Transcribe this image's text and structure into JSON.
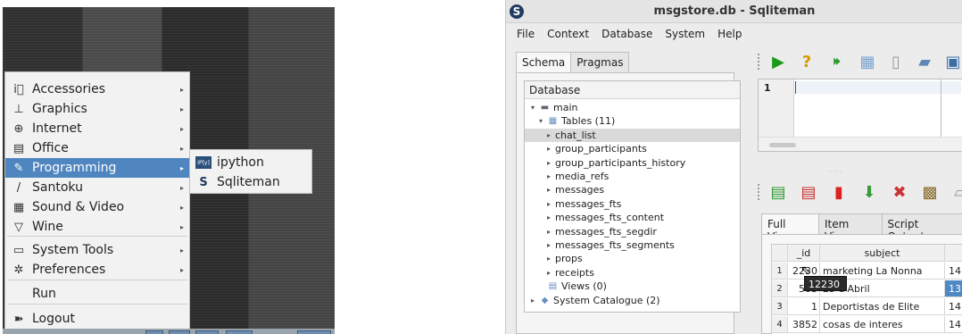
{
  "start_menu": {
    "items": [
      {
        "label": "Accessories",
        "icon": "accessories-icon",
        "glyph": "i⃓",
        "submenu": true
      },
      {
        "label": "Graphics",
        "icon": "graphics-icon",
        "glyph": "⊥",
        "submenu": true
      },
      {
        "label": "Internet",
        "icon": "internet-icon",
        "glyph": "⊕",
        "submenu": true
      },
      {
        "label": "Office",
        "icon": "office-icon",
        "glyph": "▤",
        "submenu": true
      },
      {
        "label": "Programming",
        "icon": "programming-icon",
        "glyph": "✎",
        "submenu": true,
        "highlighted": true
      },
      {
        "label": "Santoku",
        "icon": "santoku-icon",
        "glyph": "/",
        "submenu": true
      },
      {
        "label": "Sound & Video",
        "icon": "sound-video-icon",
        "glyph": "▦",
        "submenu": true
      },
      {
        "label": "Wine",
        "icon": "wine-icon",
        "glyph": "▽",
        "submenu": true
      },
      {
        "label": "System Tools",
        "icon": "system-tools-icon",
        "glyph": "▭",
        "submenu": true
      },
      {
        "label": "Preferences",
        "icon": "preferences-icon",
        "glyph": "✲",
        "submenu": true
      },
      {
        "label": "Run",
        "icon": "",
        "glyph": "",
        "submenu": false
      },
      {
        "label": "Logout",
        "icon": "logout-icon",
        "glyph": "➽",
        "submenu": false
      }
    ],
    "submenu_arrow": "▸",
    "highlight_color": "#4f86c0"
  },
  "programming_submenu": {
    "items": [
      {
        "label": "ipython",
        "icon": "ipython-icon",
        "glyph": "IP[y]"
      },
      {
        "label": "Sqliteman",
        "icon": "sqliteman-icon",
        "glyph": "S"
      }
    ]
  },
  "window": {
    "title": "msgstore.db - Sqliteman",
    "logo_glyph": "S",
    "menus": [
      "File",
      "Context",
      "Database",
      "System",
      "Help"
    ]
  },
  "schema": {
    "tabs": [
      "Schema",
      "Pragmas"
    ],
    "tree_header": "Database",
    "tree": [
      {
        "label": "main",
        "level": 0,
        "twisty": "▾",
        "icon": "database-icon",
        "glyph": "▬"
      },
      {
        "label": "Tables (11)",
        "level": 1,
        "twisty": "▾",
        "icon": "tables-icon",
        "glyph": "▦"
      },
      {
        "label": "chat_list",
        "level": 2,
        "twisty": "▸",
        "selected": true
      },
      {
        "label": "group_participants",
        "level": 2,
        "twisty": "▸"
      },
      {
        "label": "group_participants_history",
        "level": 2,
        "twisty": "▸"
      },
      {
        "label": "media_refs",
        "level": 2,
        "twisty": "▸"
      },
      {
        "label": "messages",
        "level": 2,
        "twisty": "▸"
      },
      {
        "label": "messages_fts",
        "level": 2,
        "twisty": "▸"
      },
      {
        "label": "messages_fts_content",
        "level": 2,
        "twisty": "▸"
      },
      {
        "label": "messages_fts_segdir",
        "level": 2,
        "twisty": "▸"
      },
      {
        "label": "messages_fts_segments",
        "level": 2,
        "twisty": "▸"
      },
      {
        "label": "props",
        "level": 2,
        "twisty": "▸"
      },
      {
        "label": "receipts",
        "level": 2,
        "twisty": "▸"
      },
      {
        "label": "Views (0)",
        "level": 1,
        "twisty": "",
        "icon": "views-icon",
        "glyph": "▤"
      },
      {
        "label": "System Catalogue (2)",
        "level": 0,
        "twisty": "▸",
        "icon": "system-catalogue-icon",
        "glyph": "◆"
      }
    ]
  },
  "editor": {
    "line_number": "1",
    "toolbar_icons": [
      "run-sql-icon",
      "explain-icon",
      "run-script-icon",
      "history-icon",
      "new-file-icon",
      "open-file-icon",
      "save-file-icon"
    ]
  },
  "results": {
    "toolbar_icons": [
      "insert-row-icon",
      "delete-row-icon",
      "remove-icon",
      "commit-icon",
      "rollback-icon",
      "image-icon",
      "export-icon"
    ],
    "tabs": [
      "Full View",
      "Item View",
      "Script Output"
    ],
    "columns": [
      "_id",
      "subject",
      ""
    ],
    "rows": [
      {
        "num": "1",
        "id": "2230",
        "subject": "marketing La Nonna",
        "extra": "14"
      },
      {
        "num": "2",
        "id": "503",
        "subject": "25 d'Abril",
        "extra": "13"
      },
      {
        "num": "3",
        "id": "1",
        "subject": "Deportistas de Elite",
        "extra": "14"
      },
      {
        "num": "4",
        "id": "3852",
        "subject": "cosas de interes",
        "extra": "14"
      }
    ],
    "tooltip": "12230",
    "selection_color": "#4e89c6"
  }
}
